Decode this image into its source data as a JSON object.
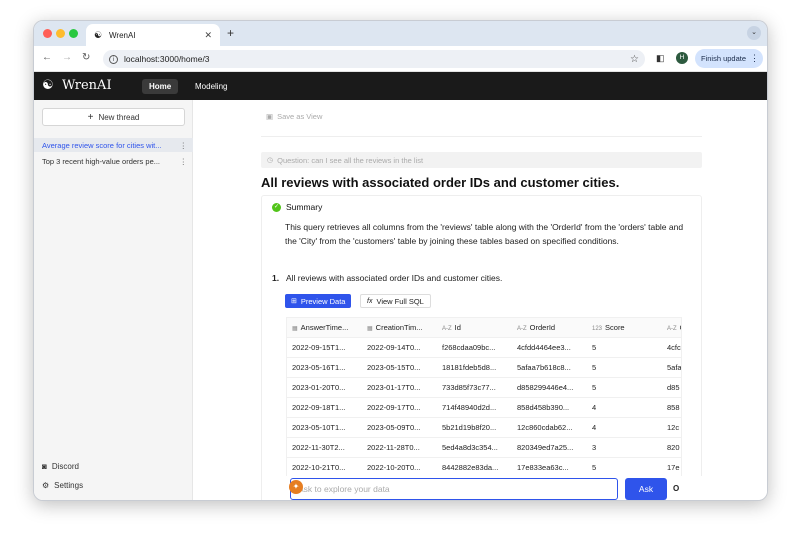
{
  "browser": {
    "tab_title": "WrenAI",
    "url": "localhost:3000/home/3",
    "profile_initial": "H",
    "finish_update": "Finish update"
  },
  "app": {
    "logo_text": "WrenAI",
    "nav": {
      "home": "Home",
      "modeling": "Modeling"
    }
  },
  "sidebar": {
    "new_thread": "New thread",
    "threads": [
      {
        "label": "Average review score for cities wit..."
      },
      {
        "label": "Top 3 recent high-value orders pe..."
      }
    ],
    "footer": {
      "discord": "Discord",
      "settings": "Settings"
    }
  },
  "main": {
    "save_as_view": "Save as View",
    "question_label": "Question:",
    "question_text": "can I see all the reviews in the list",
    "title": "All reviews with associated order IDs and customer cities.",
    "summary_heading": "Summary",
    "summary_text": "This query retrieves all columns from the 'reviews' table along with the 'OrderId' from the 'orders' table and the 'City' from the 'customers' table by joining these tables based on specified conditions.",
    "step_number": "1.",
    "step_text": "All reviews with associated order IDs and customer cities.",
    "preview_data": "Preview Data",
    "view_full_sql": "View Full SQL",
    "table": {
      "columns": [
        {
          "icon": "calendar-icon",
          "label": "AnswerTime..."
        },
        {
          "icon": "calendar-icon",
          "label": "CreationTim..."
        },
        {
          "icon": "text-type-icon",
          "label": "Id"
        },
        {
          "icon": "text-type-icon",
          "label": "OrderId"
        },
        {
          "icon": "number-type-icon",
          "label": "Score"
        },
        {
          "icon": "text-type-icon",
          "label": "C"
        }
      ],
      "rows": [
        [
          "2022-09-15T1...",
          "2022-09-14T0...",
          "f268cdaa09bc...",
          "4cfdd4464ee3...",
          "5",
          "4cfc"
        ],
        [
          "2023-05-16T1...",
          "2023-05-15T0...",
          "18181fdeb5d8...",
          "5afaa7b618c8...",
          "5",
          "5afa"
        ],
        [
          "2023-01-20T0...",
          "2023-01-17T0...",
          "733d85f73c77...",
          "d858299446e4...",
          "5",
          "d85"
        ],
        [
          "2022-09-18T1...",
          "2022-09-17T0...",
          "714f48940d2d...",
          "858d458b390...",
          "4",
          "858"
        ],
        [
          "2023-05-10T1...",
          "2023-05-09T0...",
          "5b21d19b8f20...",
          "12c860cdab62...",
          "4",
          "12c"
        ],
        [
          "2022-11-30T2...",
          "2022-11-28T0...",
          "5ed4a8d3c354...",
          "820349ed7a25...",
          "3",
          "820"
        ],
        [
          "2022-10-21T0...",
          "2022-10-20T0...",
          "8442882e83da...",
          "17e833ea63c...",
          "5",
          "17e"
        ]
      ]
    },
    "ask_placeholder": "Ask to explore your data",
    "ask_button": "Ask",
    "ask_side_label": "O"
  }
}
